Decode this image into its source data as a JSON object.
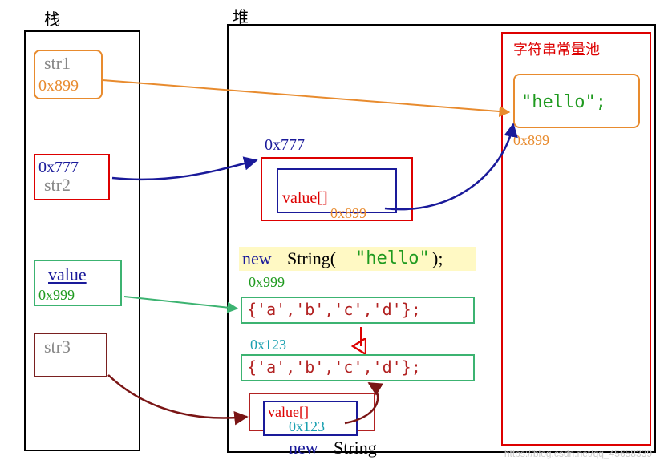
{
  "labels": {
    "stack": "栈",
    "heap": "堆",
    "pool": "字符串常量池"
  },
  "stack": {
    "str1": {
      "name": "str1",
      "addr": "0x899"
    },
    "str2": {
      "name": "str2",
      "addr": "0x777"
    },
    "value": {
      "name": "value",
      "addr": "0x999"
    },
    "str3": {
      "name": "str3"
    }
  },
  "heap": {
    "obj777": {
      "addr": "0x777",
      "field": "value[]",
      "fieldAddr": "0x899"
    },
    "newStringExpr": {
      "kw": "new ",
      "cls": "String(",
      "arg": "\"hello\"",
      "close": ");"
    },
    "arr999": {
      "addr": "0x999",
      "text": "{'a','b','c','d'};"
    },
    "arr123": {
      "addr": "0x123",
      "text": "{'a','b','c','d'};"
    },
    "obj123": {
      "field": "value[]",
      "fieldAddr": "0x123"
    },
    "bottomLabel": {
      "kw": "new ",
      "cls": "String"
    }
  },
  "pool": {
    "hello": {
      "text": "\"hello\";",
      "addr": "0x899"
    }
  },
  "watermark": "https://blog.csdn.net/qq_45658339"
}
